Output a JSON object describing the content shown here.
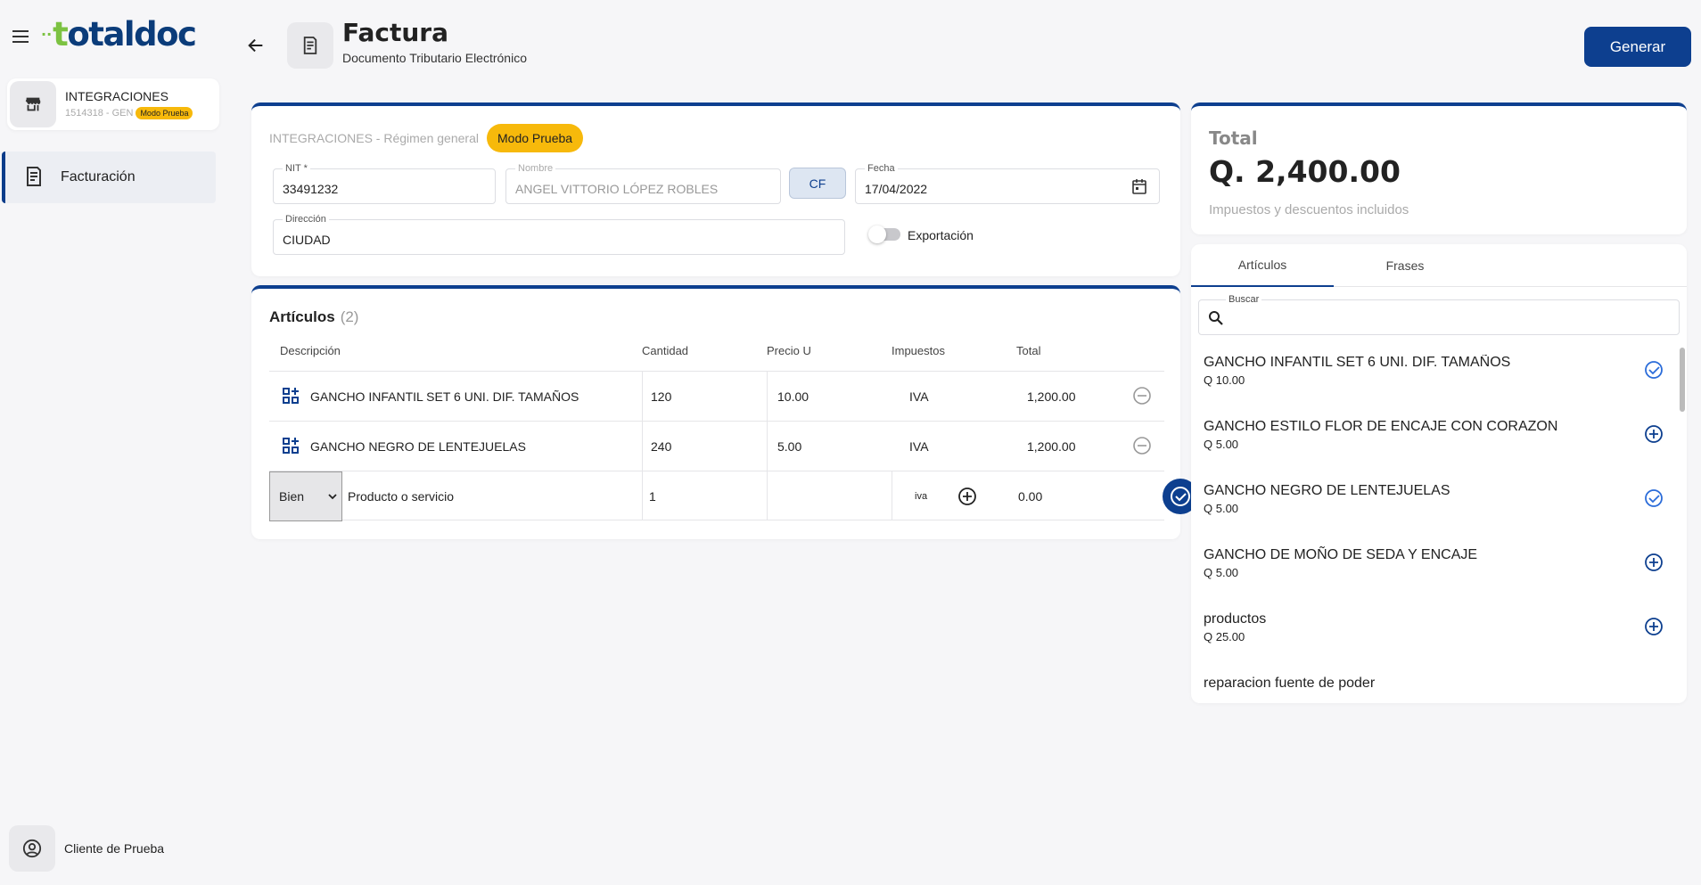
{
  "brand": {
    "logo_prefix": "t",
    "logo_rest": "otaldoc",
    "accent": "#7cc242",
    "primary": "#0d3f8f"
  },
  "sidebar": {
    "company": {
      "name": "INTEGRACIONES",
      "sub": "1514318 - GEN",
      "badge": "Modo Prueba"
    },
    "nav": [
      {
        "label": "Facturación",
        "icon": "invoice-icon"
      }
    ],
    "user": {
      "label": "Cliente de Prueba"
    }
  },
  "header": {
    "title": "Factura",
    "subtitle": "Documento Tributario Electrónico",
    "generate_label": "Generar"
  },
  "client": {
    "regimen": "INTEGRACIONES - Régimen general",
    "mode_badge": "Modo Prueba",
    "nit_label": "NIT *",
    "nit_value": "33491232",
    "nombre_label": "Nombre",
    "nombre_value": "ANGEL VITTORIO LÓPEZ ROBLES",
    "cf_label": "CF",
    "fecha_label": "Fecha",
    "fecha_value": "17/04/2022",
    "direccion_label": "Dirección",
    "direccion_value": "CIUDAD",
    "export_label": "Exportación"
  },
  "items": {
    "title": "Artículos",
    "count": "(2)",
    "columns": [
      "Descripción",
      "Cantidad",
      "Precio U",
      "Impuestos",
      "Total"
    ],
    "rows": [
      {
        "desc": "GANCHO INFANTIL SET 6 UNI. DIF. TAMAÑOS",
        "qty": "120",
        "price": "10.00",
        "tax": "IVA",
        "total": "1,200.00"
      },
      {
        "desc": "GANCHO NEGRO DE LENTEJUELAS",
        "qty": "240",
        "price": "5.00",
        "tax": "IVA",
        "total": "1,200.00"
      }
    ],
    "new_row": {
      "type": "Bien",
      "placeholder": "Producto o servicio",
      "qty": "1",
      "tax": "iva",
      "total": "0.00"
    }
  },
  "summary": {
    "label": "Total",
    "value": "Q. 2,400.00",
    "note": "Impuestos y descuentos incluidos"
  },
  "catalog": {
    "tabs": [
      "Artículos",
      "Frases"
    ],
    "search_label": "Buscar",
    "products": [
      {
        "name": "GANCHO INFANTIL SET 6 UNI. DIF. TAMAÑOS",
        "price": "Q 10.00",
        "selected": true
      },
      {
        "name": "GANCHO ESTILO FLOR DE ENCAJE CON CORAZON",
        "price": "Q 5.00",
        "selected": false
      },
      {
        "name": "GANCHO NEGRO DE LENTEJUELAS",
        "price": "Q 5.00",
        "selected": true
      },
      {
        "name": "GANCHO DE MOÑO DE SEDA Y ENCAJE",
        "price": "Q 5.00",
        "selected": false
      },
      {
        "name": "productos",
        "price": "Q 25.00",
        "selected": false
      },
      {
        "name": "reparacion fuente de poder",
        "price": "",
        "selected": false
      }
    ]
  }
}
